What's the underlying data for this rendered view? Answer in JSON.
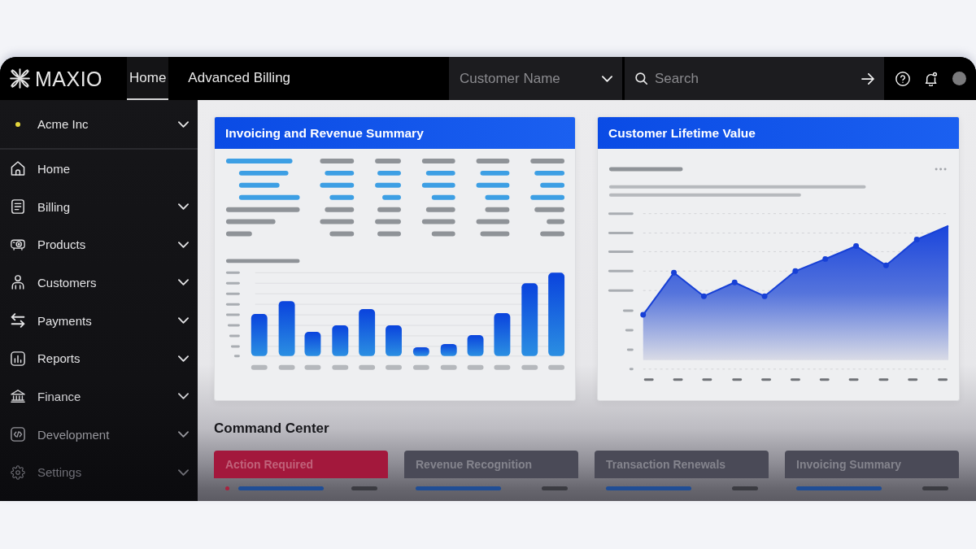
{
  "top_bar": {
    "logo": "MAXIO",
    "tabs": [
      {
        "label": "Home",
        "selected": true
      },
      {
        "label": "Advanced Billing",
        "selected": false
      }
    ],
    "customer_select": {
      "placeholder": "Customer Name"
    },
    "search": {
      "placeholder": "Search"
    }
  },
  "sidebar": {
    "organization": "Acme Inc",
    "items": [
      {
        "label": "Home",
        "has_submenu": false
      },
      {
        "label": "Billing",
        "has_submenu": true
      },
      {
        "label": "Products",
        "has_submenu": true
      },
      {
        "label": "Customers",
        "has_submenu": true
      },
      {
        "label": "Payments",
        "has_submenu": true
      },
      {
        "label": "Reports",
        "has_submenu": true
      },
      {
        "label": "Finance",
        "has_submenu": true
      },
      {
        "label": "Development",
        "has_submenu": true
      },
      {
        "label": "Settings",
        "has_submenu": true
      }
    ]
  },
  "cards": [
    {
      "kind": "bars",
      "title": "Invoicing and Revenue Summary"
    },
    {
      "kind": "area",
      "title": "Customer Lifetime Value"
    }
  ],
  "command_center": {
    "title": "Command Center",
    "cards": [
      {
        "title": "Action Required",
        "color": "#a3183c",
        "alert": true
      },
      {
        "title": "Revenue Recognition",
        "color": "#4a4a57",
        "alert": false
      },
      {
        "title": "Transaction Renewals",
        "color": "#4a4a57",
        "alert": false
      },
      {
        "title": "Invoicing Summary",
        "color": "#4a4a57",
        "alert": false
      }
    ]
  }
}
